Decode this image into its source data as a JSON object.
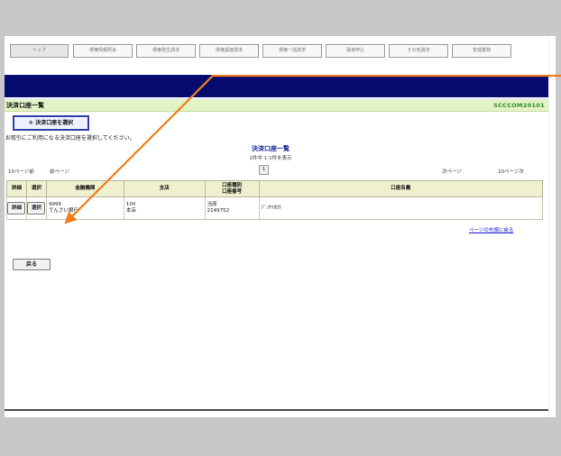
{
  "tabs": [
    {
      "label": "トップ"
    },
    {
      "label": "債権情報照会"
    },
    {
      "label": "債権発生請求"
    },
    {
      "label": "債権譲渡請求"
    },
    {
      "label": "債権一括請求"
    },
    {
      "label": "融資申込"
    },
    {
      "label": "その他請求"
    },
    {
      "label": "管理業務"
    }
  ],
  "page": {
    "title": "決済口座一覧",
    "code": "SCCCOM20101",
    "step_badge": "① 決済口座を選択",
    "instruction": "お取引にご利用になる決済口座を選択してください。"
  },
  "list": {
    "title": "決済口座一覧",
    "count": "1件中 1-1件を表示",
    "prev10": "10ページ前",
    "prev": "前ページ",
    "page_number": "1",
    "next": "次ページ",
    "next10": "10ページ次"
  },
  "table": {
    "headers": {
      "detail": "詳細",
      "select": "選択",
      "bank": "金融機関",
      "branch": "支店",
      "type_line1": "口座種別",
      "type_line2": "口座番号",
      "name": "口座名義"
    },
    "rows": [
      {
        "detail_btn": "詳細",
        "select_btn": "選択",
        "bank_code": "9999",
        "bank_name": "でんさい銀行",
        "branch_code": "100",
        "branch_name": "本店",
        "account_type": "当座",
        "account_number": "2149752",
        "account_name": "ﾃﾞﾝｻｲﾀﾛｳ"
      }
    ]
  },
  "links": {
    "page_top": "ページの先頭に戻る"
  },
  "buttons": {
    "back": "戻る"
  },
  "colors": {
    "nav_bar": "#070a6e",
    "title_bar": "#e3f3c4",
    "annotation_arrow": "#f07d1a",
    "screen_code": "#2a8a2a"
  }
}
